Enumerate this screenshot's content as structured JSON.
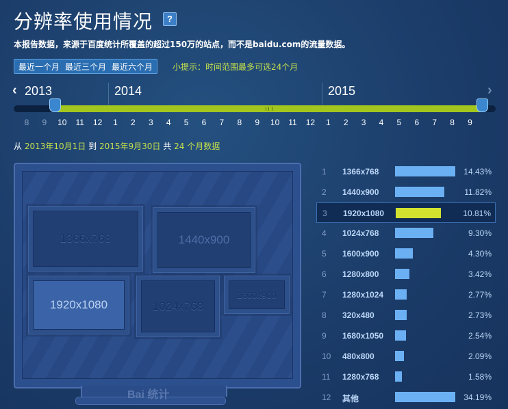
{
  "header": {
    "title": "分辨率使用情况",
    "help": "?",
    "subtitle": "本报告数据，来源于百度统计所覆盖的超过150万的站点，而不是baidu.com的流量数据。"
  },
  "range_buttons": [
    "最近一个月",
    "最近三个月",
    "最近六个月"
  ],
  "tip": "小提示：时间范围最多可选24个月",
  "timeline": {
    "years": [
      "2013",
      "2014",
      "2015"
    ],
    "months": [
      "8",
      "9",
      "10",
      "11",
      "12",
      "1",
      "2",
      "3",
      "4",
      "5",
      "6",
      "7",
      "8",
      "9",
      "10",
      "11",
      "12",
      "1",
      "2",
      "3",
      "4",
      "5",
      "6",
      "7",
      "8",
      "9"
    ],
    "selected_from_index": 2,
    "selected_to_index": 25
  },
  "date_range": {
    "from_label": "从",
    "start": "2013年10月1日",
    "to_label": "到",
    "end": "2015年9月30日",
    "total_label": "共",
    "count": "24",
    "unit": "个月数据"
  },
  "monitor": {
    "brand": "Bai 统计",
    "boxes": [
      "1366x768",
      "1440x900",
      "1920x1080",
      "1024x768",
      "1600x900"
    ]
  },
  "ranking": {
    "rows": [
      {
        "rank": "1",
        "resolution": "1366x768",
        "percent": "14.43%",
        "bar": 1.0
      },
      {
        "rank": "2",
        "resolution": "1440x900",
        "percent": "11.82%",
        "bar": 0.82
      },
      {
        "rank": "3",
        "resolution": "1920x1080",
        "percent": "10.81%",
        "bar": 0.75
      },
      {
        "rank": "4",
        "resolution": "1024x768",
        "percent": "9.30%",
        "bar": 0.64
      },
      {
        "rank": "5",
        "resolution": "1600x900",
        "percent": "4.30%",
        "bar": 0.3
      },
      {
        "rank": "6",
        "resolution": "1280x800",
        "percent": "3.42%",
        "bar": 0.24
      },
      {
        "rank": "7",
        "resolution": "1280x1024",
        "percent": "2.77%",
        "bar": 0.19
      },
      {
        "rank": "8",
        "resolution": "320x480",
        "percent": "2.73%",
        "bar": 0.19
      },
      {
        "rank": "9",
        "resolution": "1680x1050",
        "percent": "2.54%",
        "bar": 0.18
      },
      {
        "rank": "10",
        "resolution": "480x800",
        "percent": "2.09%",
        "bar": 0.145
      },
      {
        "rank": "11",
        "resolution": "1280x768",
        "percent": "1.58%",
        "bar": 0.11
      },
      {
        "rank": "12",
        "resolution": "其他",
        "percent": "34.19%",
        "bar": 1.0
      }
    ],
    "selected_index": 2
  }
}
